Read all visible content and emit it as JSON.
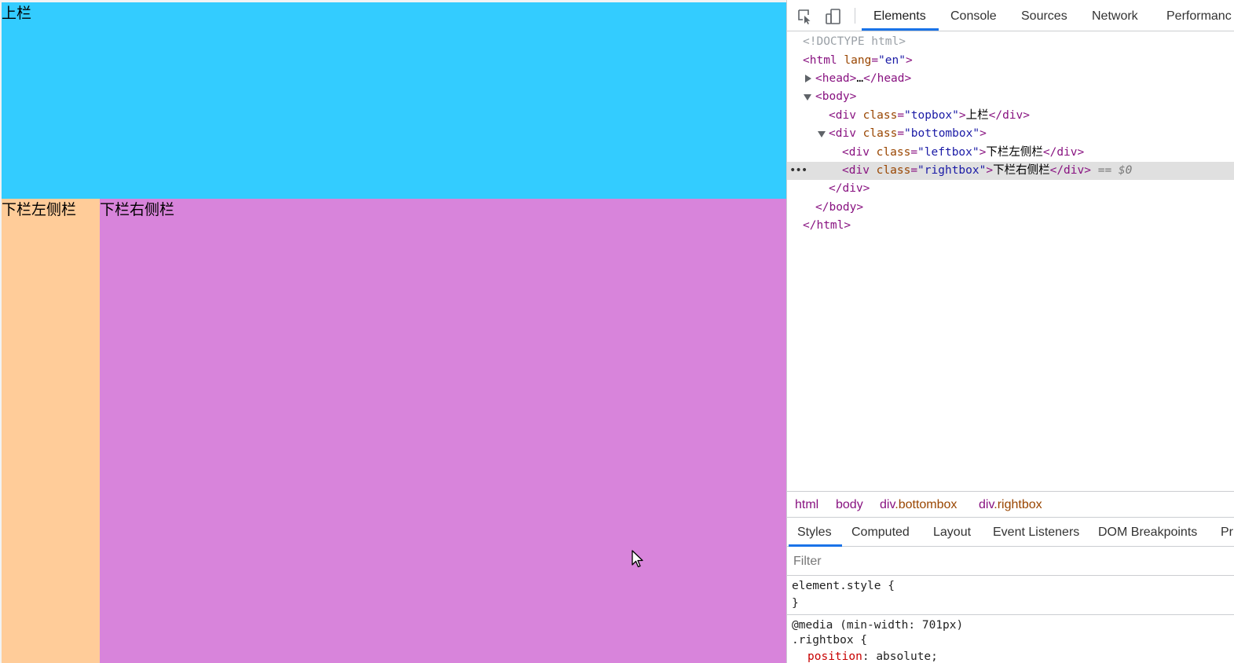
{
  "page": {
    "topbox_text": "上栏",
    "leftbox_text": "下栏左侧栏",
    "rightbox_text": "下栏右侧栏",
    "colors": {
      "topbox": "#33ccff",
      "leftbox": "#ffcc99",
      "rightbox": "#d884db"
    }
  },
  "devtools": {
    "tabs": [
      "Elements",
      "Console",
      "Sources",
      "Network",
      "Performanc"
    ],
    "active_tab": "Elements",
    "icons": [
      "inspect-element-icon",
      "device-toolbar-icon"
    ],
    "dom": {
      "doctype": "<!DOCTYPE html>",
      "html_open": {
        "tag": "<html",
        "attr": "lang",
        "value": "\"en\"",
        "close": ">"
      },
      "head": {
        "open": "<head>",
        "ellipsis": "…",
        "close": "</head>"
      },
      "body_open": "<body>",
      "topbox": {
        "tag": "<div",
        "attr": "class",
        "value": "\"topbox\"",
        "gt": ">",
        "text": "上栏",
        "close": "</div>"
      },
      "bottombox": {
        "tag": "<div",
        "attr": "class",
        "value": "\"bottombox\"",
        "gt": ">"
      },
      "leftbox": {
        "tag": "<div",
        "attr": "class",
        "value": "\"leftbox\"",
        "gt": ">",
        "text": "下栏左侧栏",
        "close": "</div>"
      },
      "rightbox": {
        "tag": "<div",
        "attr": "class",
        "value": "\"rightbox\"",
        "gt": ">",
        "text": "下栏右侧栏",
        "close": "</div>",
        "eq": "== $0"
      },
      "div_close": "</div>",
      "body_close": "</body>",
      "html_close": "</html>",
      "dots": "•••"
    },
    "breadcrumbs": [
      {
        "tag": "html",
        "cls": ""
      },
      {
        "tag": "body",
        "cls": ""
      },
      {
        "tag": "div",
        "cls": ".bottombox"
      },
      {
        "tag": "div",
        "cls": ".rightbox"
      }
    ],
    "style_tabs": [
      "Styles",
      "Computed",
      "Layout",
      "Event Listeners",
      "DOM Breakpoints",
      "Pr"
    ],
    "active_style_tab": "Styles",
    "filter_placeholder": "Filter",
    "styles": {
      "element_style_open": "element.style {",
      "element_style_close": "}",
      "media": "@media (min-width: 701px)",
      "selector": ".rightbox {",
      "prop_name": "position",
      "prop_value": "absolute;"
    }
  }
}
